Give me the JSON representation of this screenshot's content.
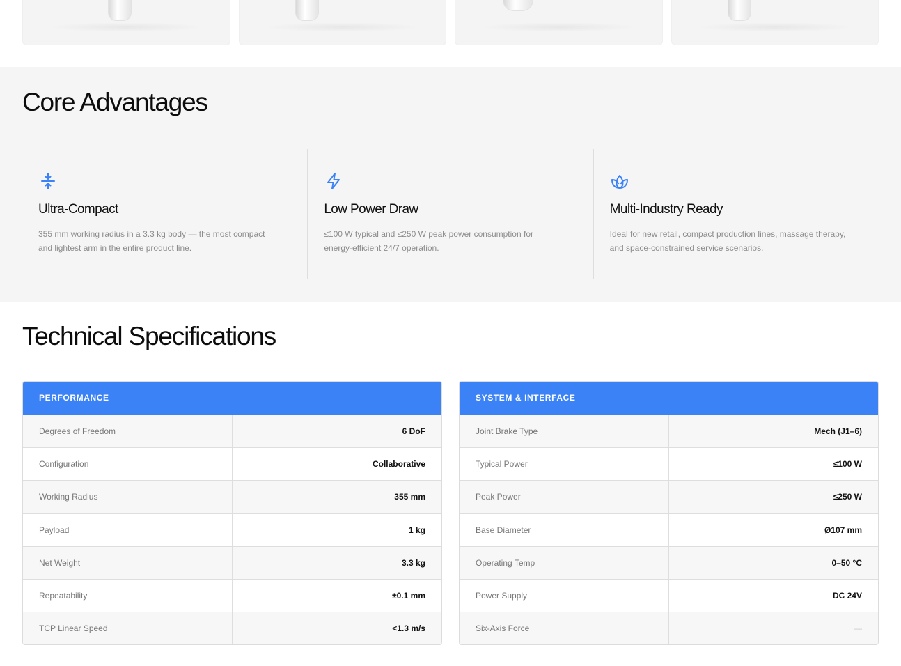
{
  "gallery": {
    "cards": 4
  },
  "core": {
    "title": "Core Advantages",
    "items": [
      {
        "icon": "compress-vertical-icon",
        "title": "Ultra-Compact",
        "text": "355 mm working radius in a 3.3 kg body — the most compact and lightest arm in the entire product line."
      },
      {
        "icon": "lightning-bolt-icon",
        "title": "Low Power Draw",
        "text": "≤100 W typical and ≤250 W peak power consumption for energy-efficient 24/7 operation."
      },
      {
        "icon": "lotus-icon",
        "title": "Multi-Industry Ready",
        "text": "Ideal for new retail, compact production lines, massage therapy, and space-constrained service scenarios."
      }
    ]
  },
  "specs": {
    "title": "Technical Specifications",
    "performance": {
      "header": "PERFORMANCE",
      "rows": [
        {
          "label": "Degrees of Freedom",
          "value": "6 DoF"
        },
        {
          "label": "Configuration",
          "value": "Collaborative"
        },
        {
          "label": "Working Radius",
          "value": "355 mm"
        },
        {
          "label": "Payload",
          "value": "1 kg"
        },
        {
          "label": "Net Weight",
          "value": "3.3 kg"
        },
        {
          "label": "Repeatability",
          "value": "±0.1 mm"
        },
        {
          "label": "TCP Linear Speed",
          "value": "<1.3 m/s"
        }
      ]
    },
    "system": {
      "header": "SYSTEM & INTERFACE",
      "rows": [
        {
          "label": "Joint Brake Type",
          "value": "Mech (J1–6)"
        },
        {
          "label": "Typical Power",
          "value": "≤100 W"
        },
        {
          "label": "Peak Power",
          "value": "≤250 W"
        },
        {
          "label": "Base Diameter",
          "value": "Ø107 mm"
        },
        {
          "label": "Operating Temp",
          "value": "0–50 °C"
        },
        {
          "label": "Power Supply",
          "value": "DC 24V"
        },
        {
          "label": "Six-Axis Force",
          "value": "—"
        }
      ]
    }
  },
  "colors": {
    "accent": "#3b82f6",
    "section_bg": "#f5f5f5"
  }
}
